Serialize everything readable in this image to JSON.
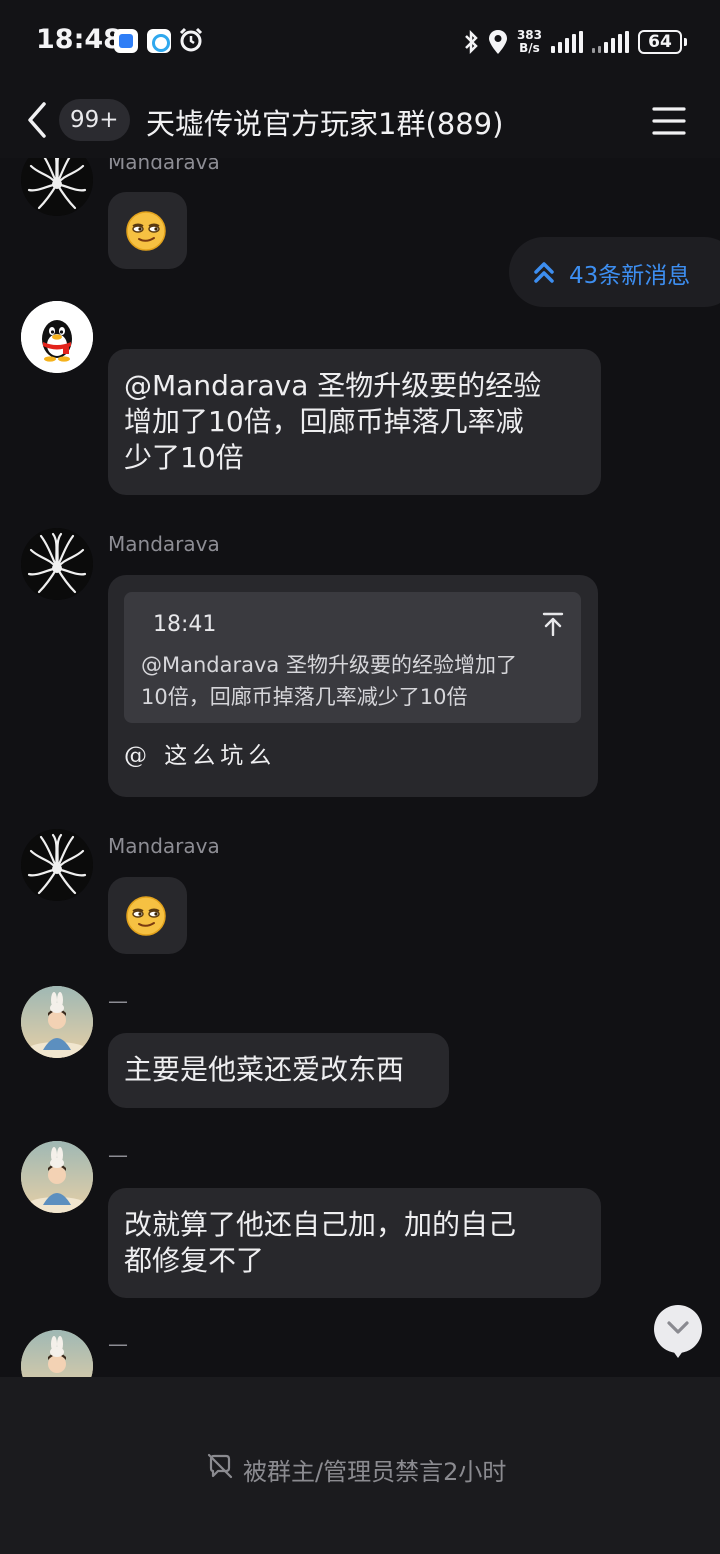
{
  "status_bar": {
    "time": "18:48",
    "net_speed_value": "383",
    "net_speed_unit": "B/s",
    "battery": "64",
    "icons": [
      "app-notification-icon",
      "app-notification-icon",
      "alarm-icon",
      "bluetooth-icon",
      "location-icon",
      "signal-icon",
      "signal-icon",
      "battery-icon"
    ]
  },
  "header": {
    "unread_count": "99+",
    "title": "天墟传说官方玩家1群(889)",
    "icons": [
      "back-arrow-icon",
      "menu-icon"
    ]
  },
  "new_messages": {
    "label": "43条新消息",
    "icon": "double-chevron-up-icon",
    "color": "#3d8ef0"
  },
  "messages": [
    {
      "sender": "Mandarava",
      "type": "emoji",
      "emoji": "smirk-emoji-icon"
    },
    {
      "sender": "",
      "type": "text",
      "lines": [
        "@Mandarava 圣物升级要的经验",
        "增加了10倍，回廊币掉落几率减",
        "少了10倍"
      ]
    },
    {
      "sender": "Mandarava",
      "type": "reply",
      "quote_time": "18:41",
      "quote_lines": [
        "@Mandarava 圣物升级要的经验增加了",
        "10倍，回廊币掉落几率减少了10倍"
      ],
      "text": "@ 这么坑么"
    },
    {
      "sender": "Mandarava",
      "type": "emoji",
      "emoji": "smirk-emoji-icon"
    },
    {
      "sender": "—",
      "type": "text",
      "lines": [
        "主要是他菜还爱改东西"
      ]
    },
    {
      "sender": "—",
      "type": "text",
      "lines": [
        "改就算了他还自己加，加的自己",
        "都修复不了"
      ]
    },
    {
      "sender": "—",
      "type": "partial"
    }
  ],
  "mute_bar": {
    "label": "被群主/管理员禁言2小时",
    "icon": "muted-icon"
  },
  "colors": {
    "background": "#111114",
    "bubble": "#28282c",
    "accent": "#3d8ef0"
  }
}
